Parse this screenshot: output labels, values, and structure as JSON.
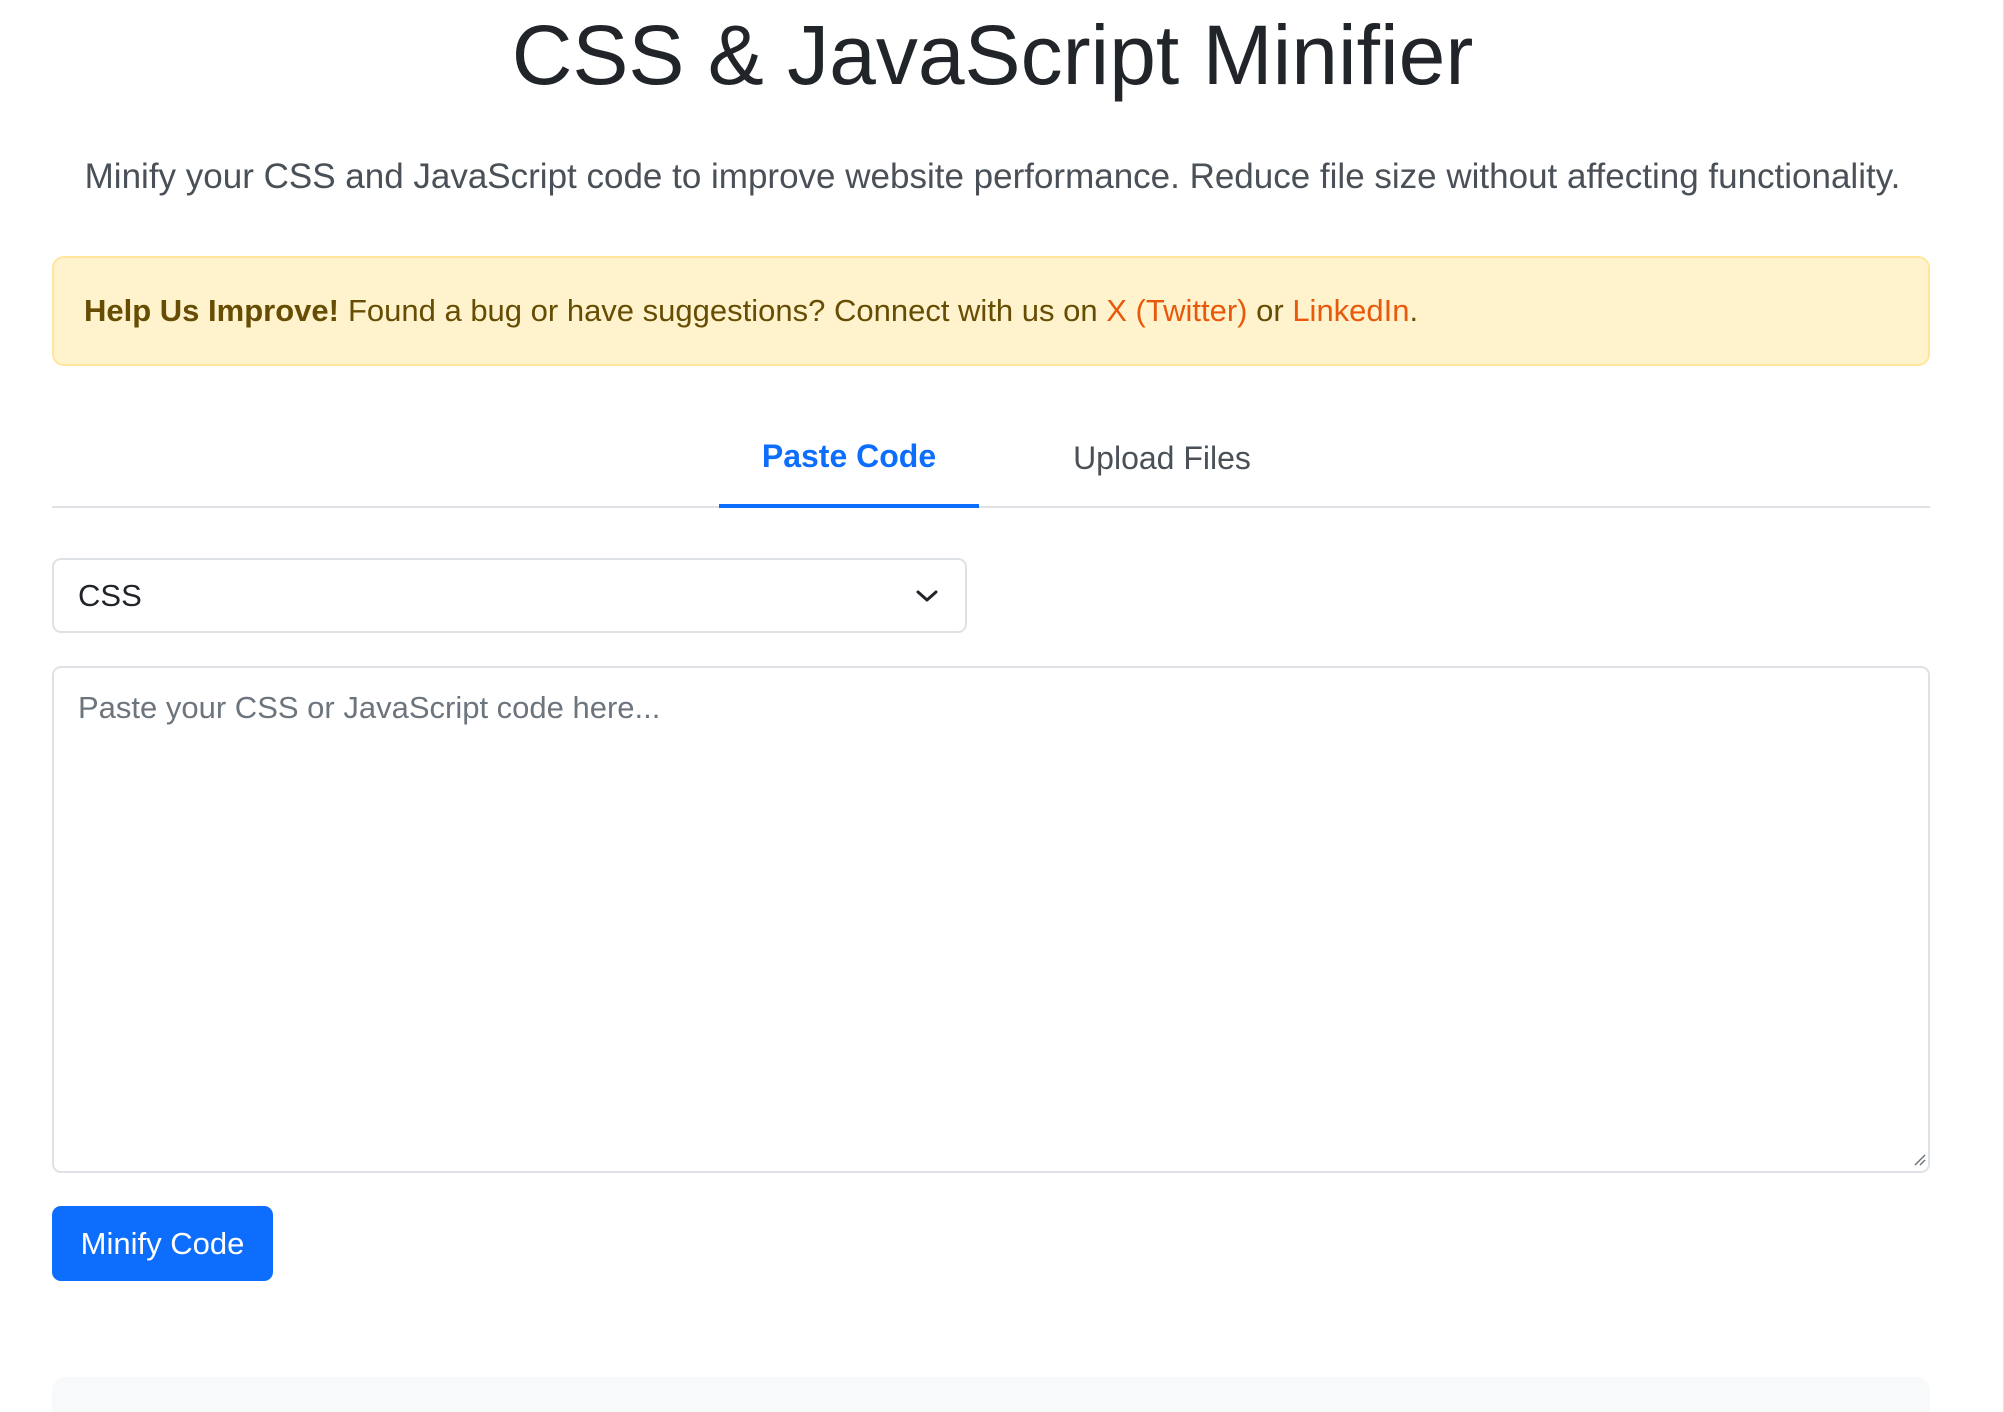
{
  "page": {
    "title": "CSS & JavaScript Minifier",
    "subtitle": "Minify your CSS and JavaScript code to improve website performance. Reduce file size without affecting functionality."
  },
  "alert": {
    "heading": "Help Us Improve!",
    "text": "Found a bug or have suggestions? Connect with us on",
    "link_twitter": "X (Twitter)",
    "joiner": "or",
    "link_linkedin": "LinkedIn",
    "end": "."
  },
  "tabs": [
    {
      "label": "Paste Code",
      "active": true
    },
    {
      "label": "Upload Files",
      "active": false
    }
  ],
  "language_select": {
    "selected": "CSS",
    "icon": "chevron-down-icon"
  },
  "code_input": {
    "value": "",
    "placeholder": "Paste your CSS or JavaScript code here..."
  },
  "actions": {
    "minify_label": "Minify Code"
  },
  "colors": {
    "accent": "#0d6efd",
    "alert_bg": "#fff3cd",
    "alert_text": "#664d03",
    "link": "#e8590c"
  }
}
